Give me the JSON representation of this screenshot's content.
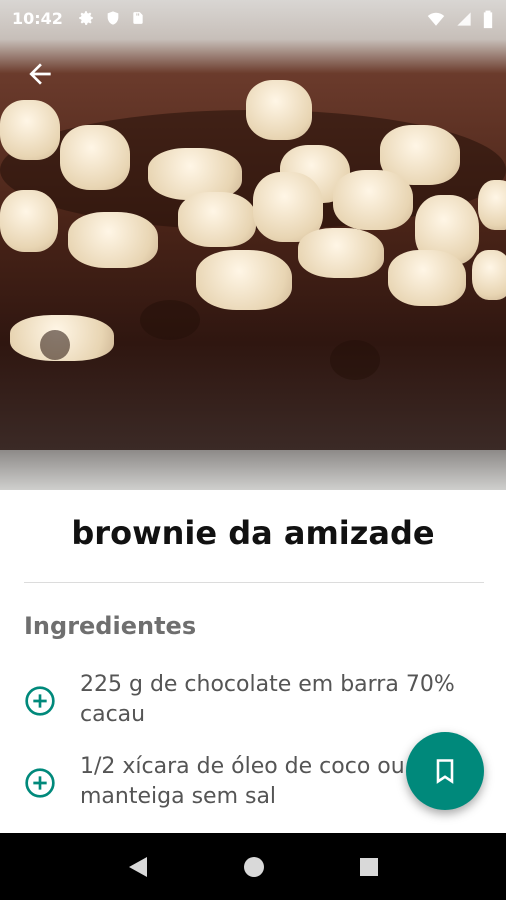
{
  "status_bar": {
    "time": "10:42"
  },
  "recipe": {
    "title": "brownie da amizade"
  },
  "ingredients": {
    "heading": "Ingredientes",
    "items": [
      {
        "text": "225 g de chocolate em barra 70% cacau"
      },
      {
        "text": "1/2 xícara de óleo de coco ou manteiga sem sal"
      }
    ]
  },
  "colors": {
    "accent": "#00897b",
    "nav_bg": "#000000"
  },
  "icons": {
    "back": "arrow-back-icon",
    "add": "add-circle-icon",
    "bookmark": "bookmark-icon",
    "nav": [
      "back-triangle-icon",
      "home-circle-icon",
      "recents-square-icon"
    ]
  }
}
